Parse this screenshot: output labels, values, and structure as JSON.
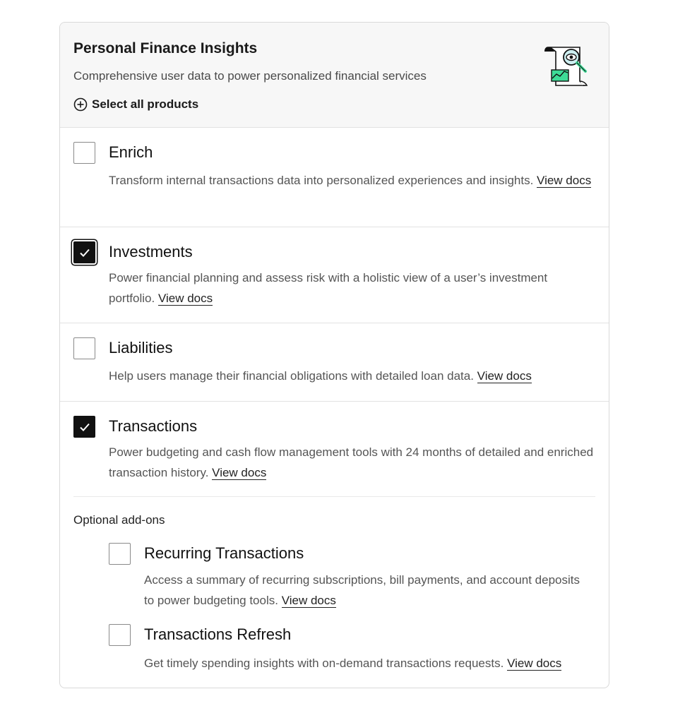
{
  "header": {
    "title": "Personal Finance Insights",
    "subtitle": "Comprehensive user data to power personalized financial services",
    "select_all_label": "Select all products",
    "select_all_icon": "plus-circle-icon",
    "illustration": "document-magnifier-eye-illustration",
    "accent_color": "#3ddc97"
  },
  "products": {
    "enrich": {
      "name": "Enrich",
      "checked": false,
      "description": "Transform internal transactions data into personalized experiences and insights.",
      "link": "View docs"
    },
    "investments": {
      "name": "Investments",
      "checked": true,
      "description": "Power financial planning and assess risk with a holistic view of a user’s investment portfolio.",
      "link": "View docs"
    },
    "liabilities": {
      "name": "Liabilities",
      "checked": false,
      "description": "Help users manage their financial obligations with detailed loan data.",
      "link": "View docs"
    },
    "transactions": {
      "name": "Transactions",
      "checked": true,
      "description": "Power budgeting and cash flow management tools with 24 months of detailed and enriched transaction history.",
      "link": "View docs"
    }
  },
  "addons": {
    "label": "Optional add-ons",
    "recurring": {
      "name": "Recurring Transactions",
      "checked": false,
      "description": "Access a summary of recurring subscriptions, bill payments, and account deposits to power budgeting tools.",
      "link": "View docs"
    },
    "refresh": {
      "name": "Transactions Refresh",
      "checked": false,
      "description": "Get timely spending insights with on-demand transactions requests.",
      "link": "View docs"
    }
  }
}
